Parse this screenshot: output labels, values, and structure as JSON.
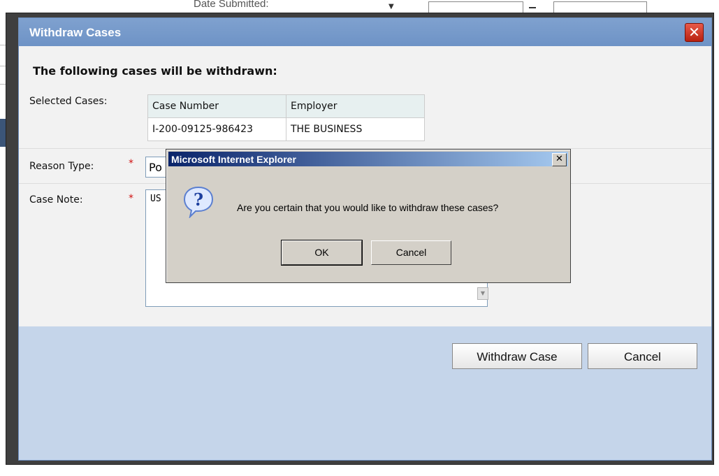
{
  "background": {
    "filter_label": "Date Submitted:"
  },
  "dialog": {
    "title": "Withdraw Cases",
    "heading": "The following cases will be withdrawn:",
    "selected_cases_label": "Selected Cases:",
    "table": {
      "headers": [
        "Case Number",
        "Employer"
      ],
      "rows": [
        [
          "I-200-09125-986423",
          "THE BUSINESS"
        ]
      ]
    },
    "reason_type_label": "Reason Type:",
    "reason_type_value": "Po",
    "case_note_label": "Case Note:",
    "case_note_value": "US",
    "required_marker": "*",
    "withdraw_button": "Withdraw Case",
    "cancel_button": "Cancel"
  },
  "alert": {
    "title": "Microsoft Internet Explorer",
    "message": "Are you certain that you would like to withdraw these cases?",
    "ok_button": "OK",
    "cancel_button": "Cancel",
    "icon": "question-icon"
  },
  "colors": {
    "titlebar": "#6e93c6",
    "footer": "#c5d5ea",
    "required": "#d01010",
    "alert_titlebar": "#0a246a"
  }
}
